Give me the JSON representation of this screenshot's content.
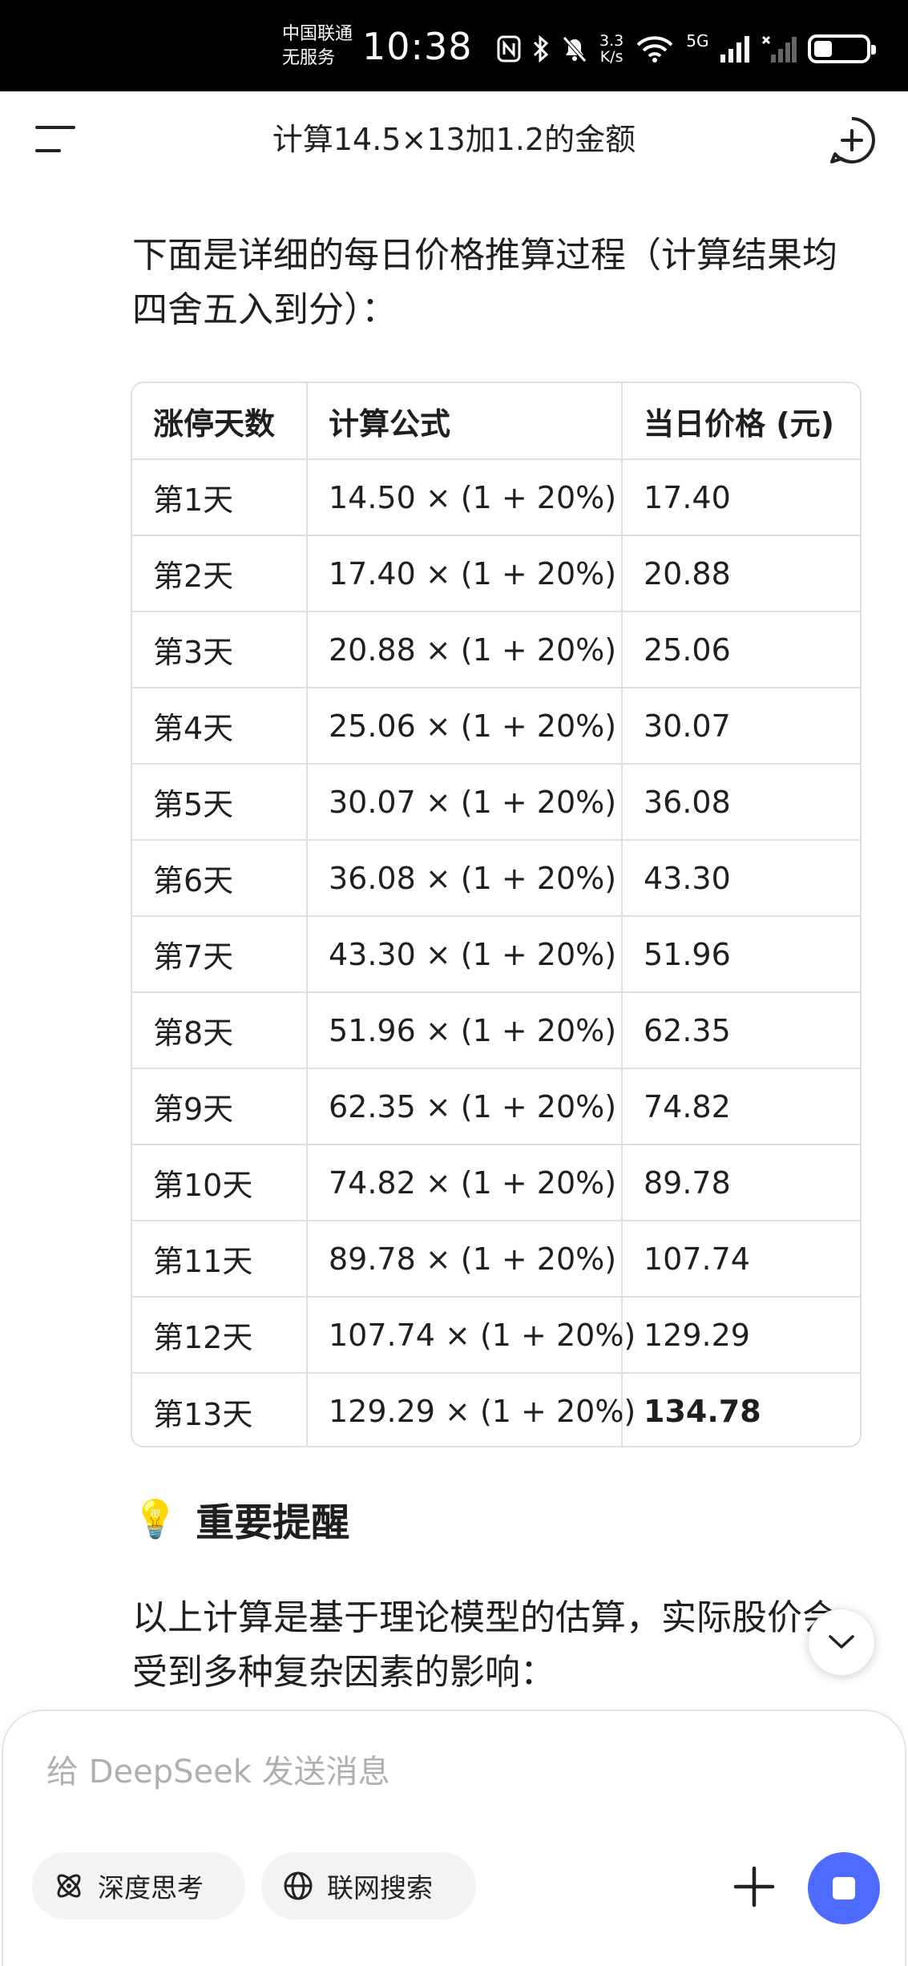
{
  "status_bar": {
    "carrier_line1": "中国联通",
    "carrier_line2": "无服务",
    "time": "10:38",
    "net_speed_value": "3.3",
    "net_speed_unit": "K/s",
    "signal_label": "5G",
    "battery_level": 0.35
  },
  "header": {
    "title": "计算14.5×13加1.2的金额"
  },
  "content": {
    "intro": "下面是详细的每日价格推算过程（计算结果均四舍五入到分）：",
    "table": {
      "headers": [
        "涨停天数",
        "计算公式",
        "当日价格 (元)"
      ],
      "rows": [
        [
          "第1天",
          "14.50 × (1 + 20%)",
          "17.40"
        ],
        [
          "第2天",
          "17.40 × (1 + 20%)",
          "20.88"
        ],
        [
          "第3天",
          "20.88 × (1 + 20%)",
          "25.06"
        ],
        [
          "第4天",
          "25.06 × (1 + 20%)",
          "30.07"
        ],
        [
          "第5天",
          "30.07 × (1 + 20%)",
          "36.08"
        ],
        [
          "第6天",
          "36.08 × (1 + 20%)",
          "43.30"
        ],
        [
          "第7天",
          "43.30 × (1 + 20%)",
          "51.96"
        ],
        [
          "第8天",
          "51.96 × (1 + 20%)",
          "62.35"
        ],
        [
          "第9天",
          "62.35 × (1 + 20%)",
          "74.82"
        ],
        [
          "第10天",
          "74.82 × (1 + 20%)",
          "89.78"
        ],
        [
          "第11天",
          "89.78 × (1 + 20%)",
          "107.74"
        ],
        [
          "第12天",
          "107.74 × (1 + 20%)",
          "129.29"
        ],
        [
          "第13天",
          "129.29 × (1 + 20%)",
          "134.78"
        ]
      ]
    },
    "reminder_emoji": "💡",
    "reminder_title": "重要提醒",
    "body_line1": "以上计算是基于理论模型的估算，实际股价会",
    "body_line2": "受到多种复杂因素的影响："
  },
  "composer": {
    "placeholder": "给 DeepSeek 发送消息",
    "deep_think_label": "深度思考",
    "web_search_label": "联网搜索"
  },
  "colors": {
    "accent": "#4d6bfe",
    "chip_bg": "#f2f3f5",
    "border": "#dfdfdf"
  }
}
